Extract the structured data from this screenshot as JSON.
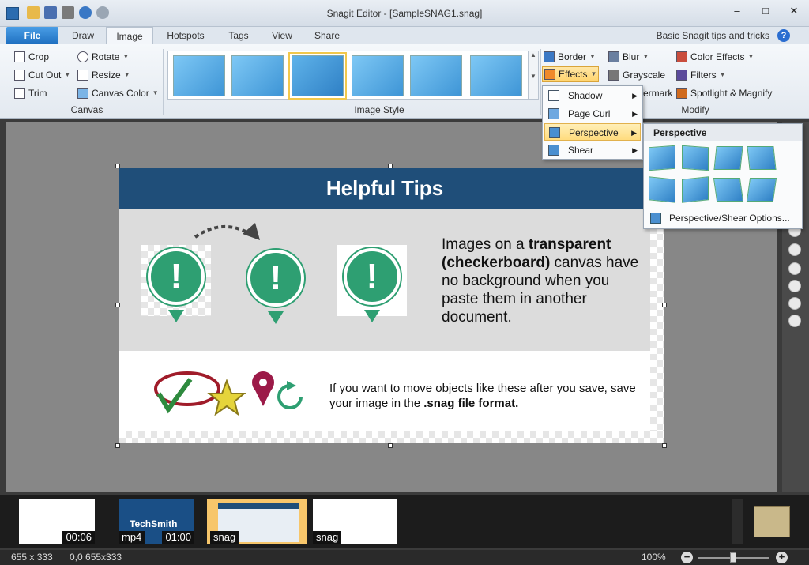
{
  "window": {
    "title": "Snagit Editor - [SampleSNAG1.snag]",
    "controls": [
      "–",
      "□",
      "✕"
    ]
  },
  "tabs": {
    "file": "File",
    "items": [
      "Draw",
      "Image",
      "Hotspots",
      "Tags",
      "View",
      "Share"
    ],
    "active": "Image",
    "tips": "Basic Snagit tips and tricks",
    "help": "?"
  },
  "ribbon": {
    "canvas": {
      "label": "Canvas",
      "crop": "Crop",
      "cut_out": "Cut Out",
      "trim": "Trim",
      "rotate": "Rotate",
      "resize": "Resize",
      "canvas_color": "Canvas Color"
    },
    "image_style": {
      "label": "Image Style",
      "selected_index": 2
    },
    "modify": {
      "label": "Modify",
      "border": "Border",
      "effects": "Effects",
      "watermark_partial": "ermark",
      "blur": "Blur",
      "grayscale": "Grayscale",
      "color_effects": "Color Effects",
      "filters": "Filters",
      "spotlight": "Spotlight & Magnify"
    }
  },
  "effects_menu": {
    "items": [
      "Shadow",
      "Page Curl",
      "Perspective",
      "Shear"
    ],
    "active": "Perspective"
  },
  "perspective_menu": {
    "header": "Perspective",
    "options_label": "Perspective/Shear Options..."
  },
  "document": {
    "heading": "Helpful Tips",
    "text1_a": "Images on a ",
    "text1_b": "transparent (checkerboard)",
    "text1_c": " canvas have no background when you paste them in another document.",
    "text2_a": "If you want to move objects like these after you save, save your image in the ",
    "text2_b": ".snag file format."
  },
  "tray": {
    "items": [
      {
        "label": "00:06"
      },
      {
        "label": "mp4",
        "label2": "01:00",
        "brand": "TechSmith"
      },
      {
        "label": "snag",
        "selected": true
      },
      {
        "label": "snag"
      }
    ]
  },
  "status": {
    "dimensions": "655 x 333",
    "position": "0,0  655x333",
    "zoom": "100%"
  },
  "colors": {
    "header_blue": "#1f4e79",
    "pin_green": "#2e9f72",
    "menu_highlight": "#ffdc7e"
  }
}
